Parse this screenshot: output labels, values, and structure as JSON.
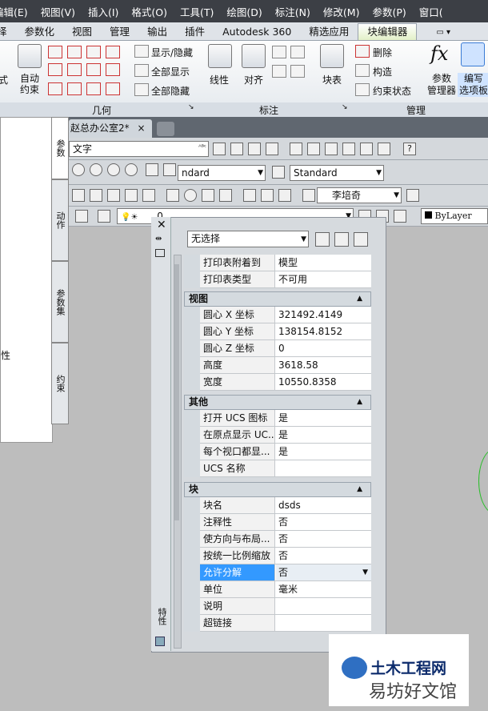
{
  "menubar": {
    "items": [
      "编辑(E)",
      "视图(V)",
      "插入(I)",
      "格式(O)",
      "工具(T)",
      "绘图(D)",
      "标注(N)",
      "修改(M)",
      "参数(P)",
      "窗口("
    ]
  },
  "ribbon_tabs": [
    "择",
    "参数化",
    "视图",
    "管理",
    "输出",
    "插件",
    "Autodesk 360",
    "精选应用",
    "块编辑器"
  ],
  "ribbon_active_tab": "块编辑器",
  "ribbon": {
    "left_cut": "式",
    "auto_constraint": "自动\n约束",
    "show_hide": "显示/隐藏",
    "show_all": "全部显示",
    "hide_all": "全部隐藏",
    "linear": "线性",
    "aligned": "对齐",
    "block_table": "块表",
    "delete": "删除",
    "construct": "构造",
    "constraint_status": "约束状态",
    "param_manager": "参数\n管理器",
    "authoring_palette": "编写\n选项板",
    "panel_geometry": "几何",
    "panel_dimension": "标注",
    "panel_manage": "管理",
    "fx": "fx"
  },
  "left_palette": {
    "partial_label": "性",
    "tabs": [
      "参数",
      "动作",
      "参数集",
      "约束"
    ]
  },
  "doc_tab": {
    "title": "赵总办公室2*",
    "close": "×"
  },
  "toolbar": {
    "search_placeholder": "文字",
    "style_left": "ndard",
    "style_right": "Standard",
    "person": "李培奇",
    "layer": "0",
    "bylayer": "ByLayer"
  },
  "properties": {
    "selection": "无选择",
    "side_label": "特性",
    "sections": [
      {
        "title": "",
        "rows": [
          {
            "key": "打印表附着到",
            "value": "模型"
          },
          {
            "key": "打印表类型",
            "value": "不可用"
          }
        ]
      },
      {
        "title": "视图",
        "rows": [
          {
            "key": "圆心 X 坐标",
            "value": "321492.4149"
          },
          {
            "key": "圆心 Y 坐标",
            "value": "138154.8152"
          },
          {
            "key": "圆心 Z 坐标",
            "value": "0"
          },
          {
            "key": "高度",
            "value": "3618.58"
          },
          {
            "key": "宽度",
            "value": "10550.8358"
          }
        ]
      },
      {
        "title": "其他",
        "rows": [
          {
            "key": "打开 UCS 图标",
            "value": "是"
          },
          {
            "key": "在原点显示 UC...",
            "value": "是"
          },
          {
            "key": "每个视口都显...",
            "value": "是"
          },
          {
            "key": "UCS 名称",
            "value": ""
          }
        ]
      },
      {
        "title": "块",
        "rows": [
          {
            "key": "块名",
            "value": "dsds"
          },
          {
            "key": "注释性",
            "value": "否"
          },
          {
            "key": "使方向与布局...",
            "value": "否"
          },
          {
            "key": "按统一比例缩放",
            "value": "否"
          },
          {
            "key": "允许分解",
            "value": "否",
            "selected": true
          },
          {
            "key": "单位",
            "value": "毫米"
          },
          {
            "key": "说明",
            "value": ""
          },
          {
            "key": "超链接",
            "value": ""
          }
        ]
      }
    ]
  },
  "watermark": {
    "brand": "土木工程网",
    "sub": "易坊好文馆"
  },
  "colors": {
    "selected": "#3399ff",
    "active_tab": "#e3f0c8",
    "menubar": "#3c3f45"
  }
}
